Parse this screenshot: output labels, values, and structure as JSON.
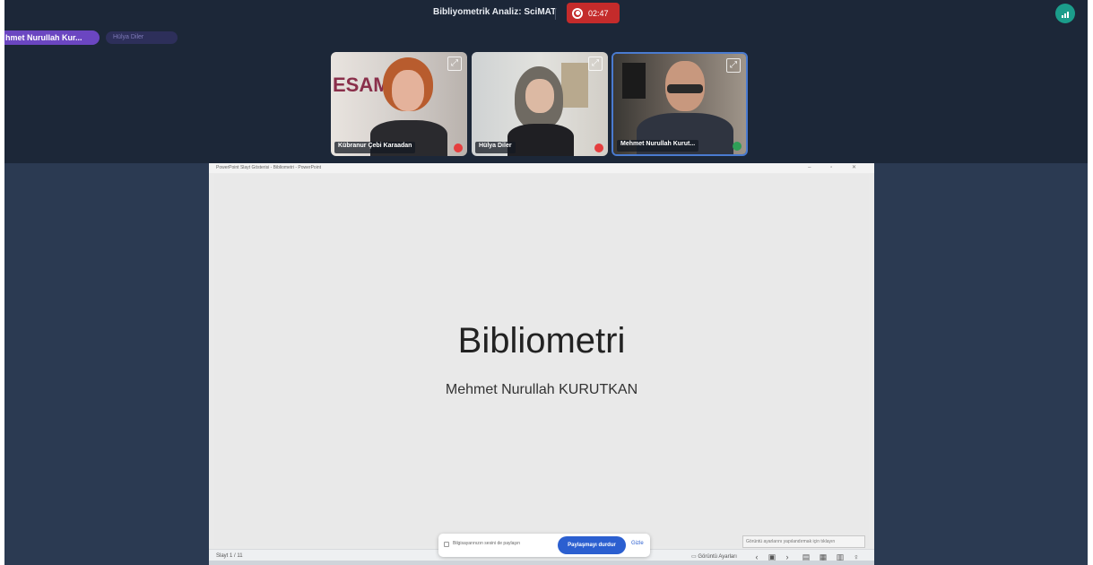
{
  "meeting": {
    "title": "Bibliyometrik Analiz: SciMAT",
    "recording_time": "02:47",
    "record_color": "#c42b2b",
    "signal_icon": "signal-bars-icon"
  },
  "speakers": {
    "active": "hmet Nurullah Kur...",
    "secondary": "Hülya Diler"
  },
  "participants": [
    {
      "name": "Kübranur Çebi Karaadan",
      "mic": "muted"
    },
    {
      "name": "Hülya Diler",
      "mic": "muted"
    },
    {
      "name": "Mehmet Nurullah Kurut...",
      "mic": "active"
    }
  ],
  "participant_badges": {
    "first_tile_logo": "ESAM"
  },
  "presentation": {
    "window_title": "PowerPoint Slayt Gösterisi - Bibliometri - PowerPoint",
    "slide_title": "Bibliometri",
    "slide_subtitle": "Mehmet Nurullah KURUTKAN",
    "slide_counter": "Slayt 1 / 11",
    "display_settings": "Görüntü Ayarları"
  },
  "share_bar": {
    "checkbox_label": "Bilgisayarınızın sesini de paylaşın",
    "stop_label": "Paylaşmayı durdur",
    "hide_label": "Gizle"
  },
  "tooltip_text": "Görüntü ayarlarını yapılandırmak için tıklayın"
}
